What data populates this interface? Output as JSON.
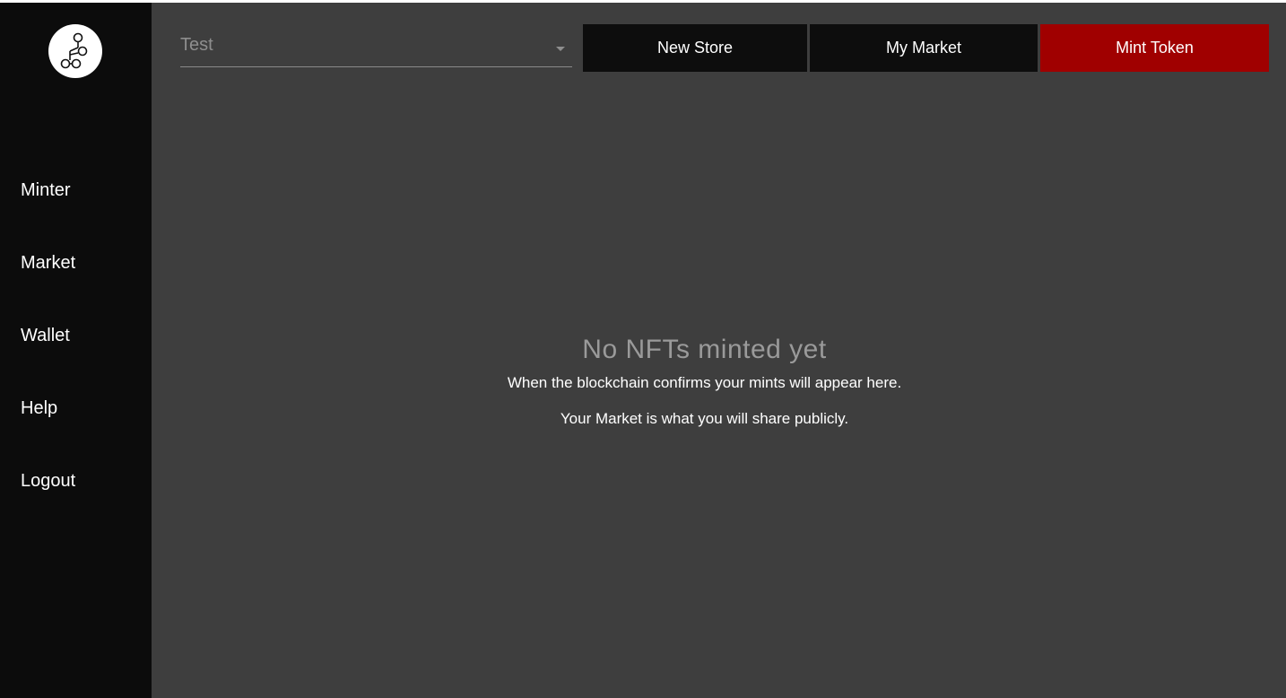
{
  "logo": {
    "icon": "network-nodes-icon"
  },
  "sidebar": {
    "items": [
      {
        "label": "Minter"
      },
      {
        "label": "Market"
      },
      {
        "label": "Wallet"
      },
      {
        "label": "Help"
      },
      {
        "label": "Logout"
      }
    ]
  },
  "header": {
    "store_select": {
      "value": "Test"
    },
    "buttons": {
      "new_store": "New Store",
      "my_market": "My Market",
      "mint_token": "Mint Token"
    }
  },
  "empty_state": {
    "title": "No NFTs minted yet",
    "line1": "When the blockchain confirms your mints will appear here.",
    "line2": "Your Market is what you will share publicly."
  },
  "colors": {
    "sidebar_bg": "#0c0c0c",
    "main_bg": "#3e3e3e",
    "button_dark": "#0d0d0d",
    "accent_red": "#a00000"
  }
}
